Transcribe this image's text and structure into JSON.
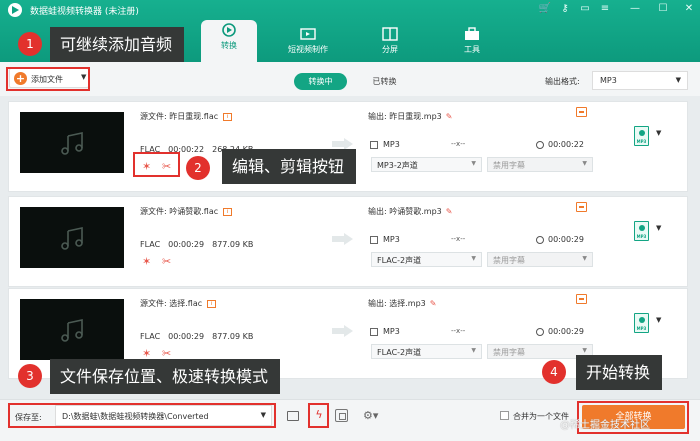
{
  "app": {
    "title": "数据蛙视频转换器  (未注册)"
  },
  "window_controls": [
    {
      "name": "cart-icon",
      "glyph": "🛒"
    },
    {
      "name": "key-icon",
      "glyph": "⚷"
    },
    {
      "name": "chat-icon",
      "glyph": "▭"
    },
    {
      "name": "menu-icon",
      "glyph": "≡"
    },
    {
      "name": "minimize-icon",
      "glyph": "—"
    },
    {
      "name": "maximize-icon",
      "glyph": "☐"
    },
    {
      "name": "close-icon",
      "glyph": "✕"
    }
  ],
  "tabs": {
    "convert": "转换",
    "short_video": "短视频制作",
    "split": "分屏",
    "tools": "工具"
  },
  "toolbar": {
    "add_file": "添加文件",
    "seg_converting": "转换中",
    "seg_converted": "已转换",
    "output_format_label": "输出格式:",
    "output_format_value": "MP3"
  },
  "rows": [
    {
      "source": "源文件: 昨日重现.flac",
      "format": "FLAC",
      "duration": "00:00:22",
      "size": "268.24 KB",
      "output": "输出: 昨日重现.mp3",
      "out_format": "MP3",
      "res": "--x--",
      "out_duration": "00:00:22",
      "audio": "MP3-2声道",
      "subtitle": "禁用字幕"
    },
    {
      "source": "源文件: 吟诵赞歌.flac",
      "format": "FLAC",
      "duration": "00:00:29",
      "size": "877.09 KB",
      "output": "输出: 吟诵赞歌.mp3",
      "out_format": "MP3",
      "res": "--x--",
      "out_duration": "00:00:29",
      "audio": "FLAC-2声道",
      "subtitle": "禁用字幕"
    },
    {
      "source": "源文件: 选择.flac",
      "format": "FLAC",
      "duration": "00:00:29",
      "size": "877.09 KB",
      "output": "输出: 选择.mp3",
      "out_format": "MP3",
      "res": "--x--",
      "out_duration": "00:00:29",
      "audio": "FLAC-2声道",
      "subtitle": "禁用字幕"
    }
  ],
  "footer": {
    "save_label": "保存至:",
    "save_path": "D:\\数据蛙\\数据蛙视频转换器\\Converted",
    "merge_label": "合并为一个文件",
    "convert_all": "全部转换"
  },
  "annotations": [
    {
      "num": "1",
      "text": "可继续添加音频"
    },
    {
      "num": "2",
      "text": "编辑、剪辑按钮"
    },
    {
      "num": "3",
      "text": "文件保存位置、极速转换模式"
    },
    {
      "num": "4",
      "text": "开始转换"
    }
  ],
  "watermark": "@稀土掘金技术社区",
  "colors": {
    "primary": "#13a584",
    "accent": "#f07a2b",
    "callout": "#e2312d"
  }
}
